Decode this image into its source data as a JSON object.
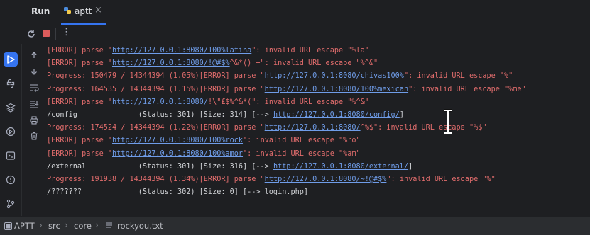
{
  "tool_window": {
    "title": "Run",
    "tab": {
      "label": "aptt",
      "icon": "python-icon",
      "close": "×"
    }
  },
  "toolbar": {
    "rerun_icon": "rerun-icon",
    "stop_icon": "stop-icon",
    "more": "⋮"
  },
  "left_strip": [
    "run-icon",
    "python-console-icon",
    "layers-icon",
    "services-icon",
    "terminal-icon",
    "problems-icon",
    "git-icon"
  ],
  "console_actions": [
    "scroll-up-icon",
    "scroll-down-icon",
    "soft-wrap-icon",
    "scroll-to-end-icon",
    "print-icon",
    "trash-icon"
  ],
  "console": {
    "lines": [
      {
        "kind": "err",
        "parts": [
          {
            "t": "[ERROR] parse \""
          },
          {
            "t": "http://127.0.0.1:8080/100%latina",
            "link": true
          },
          {
            "t": "\": invalid URL escape \"%la\""
          }
        ]
      },
      {
        "kind": "err",
        "parts": [
          {
            "t": "[ERROR] parse \""
          },
          {
            "t": "http://127.0.0.1:8080/!@#$%",
            "link": true
          },
          {
            "t": "^&*()_+\": invalid URL escape \"%^&\""
          }
        ]
      },
      {
        "kind": "prog",
        "parts": [
          {
            "t": "Progress: 150479 / 14344394 (1.05%)[ERROR] parse \""
          },
          {
            "t": "http://127.0.0.1:8080/chivas100%",
            "link": true
          },
          {
            "t": "\": invalid URL escape \"%\""
          }
        ]
      },
      {
        "kind": "prog",
        "parts": [
          {
            "t": "Progress: 164535 / 14344394 (1.15%)[ERROR] parse \""
          },
          {
            "t": "http://127.0.0.1:8080/100%mexican",
            "link": true
          },
          {
            "t": "\": invalid URL escape \"%me\""
          }
        ]
      },
      {
        "kind": "err",
        "parts": [
          {
            "t": "[ERROR] parse \""
          },
          {
            "t": "http://127.0.0.1:8080/",
            "link": true
          },
          {
            "t": "!\\\"£$%^&*(\": invalid URL escape \"%^&\""
          }
        ]
      },
      {
        "kind": "plain",
        "parts": [
          {
            "t": "/config              (Status: 301) [Size: 314] [--> "
          },
          {
            "t": "http://127.0.0.1:8080/config/",
            "link": true
          },
          {
            "t": "]"
          }
        ]
      },
      {
        "kind": "prog",
        "parts": [
          {
            "t": "Progress: 174524 / 14344394 (1.22%)[ERROR] parse \""
          },
          {
            "t": "http://127.0.0.1:8080/",
            "link": true
          },
          {
            "t": "^%$\": invalid URL escape \"%$\""
          }
        ]
      },
      {
        "kind": "err",
        "parts": [
          {
            "t": "[ERROR] parse \""
          },
          {
            "t": "http://127.0.0.1:8080/100%rock",
            "link": true
          },
          {
            "t": "\": invalid URL escape \"%ro\""
          }
        ]
      },
      {
        "kind": "err",
        "parts": [
          {
            "t": "[ERROR] parse \""
          },
          {
            "t": "http://127.0.0.1:8080/100%amor",
            "link": true
          },
          {
            "t": "\": invalid URL escape \"%am\""
          }
        ]
      },
      {
        "kind": "plain",
        "parts": [
          {
            "t": "/external            (Status: 301) [Size: 316] [--> "
          },
          {
            "t": "http://127.0.0.1:8080/external/",
            "link": true
          },
          {
            "t": "]"
          }
        ]
      },
      {
        "kind": "prog",
        "parts": [
          {
            "t": "Progress: 191938 / 14344394 (1.34%)[ERROR] parse \""
          },
          {
            "t": "http://127.0.0.1:8080/~!@#$%",
            "link": true
          },
          {
            "t": "\": invalid URL escape \"%\""
          }
        ]
      },
      {
        "kind": "plain",
        "parts": [
          {
            "t": "/???????             (Status: 302) [Size: 0] [--> login.php]"
          }
        ]
      }
    ]
  },
  "statusbar": {
    "crumbs": [
      "APTT",
      "src",
      "core",
      "rockyou.txt"
    ]
  },
  "colors": {
    "accent": "#3574f0",
    "error": "#e06c6c",
    "link": "#6f9ce8",
    "stop": "#db5c5c"
  }
}
